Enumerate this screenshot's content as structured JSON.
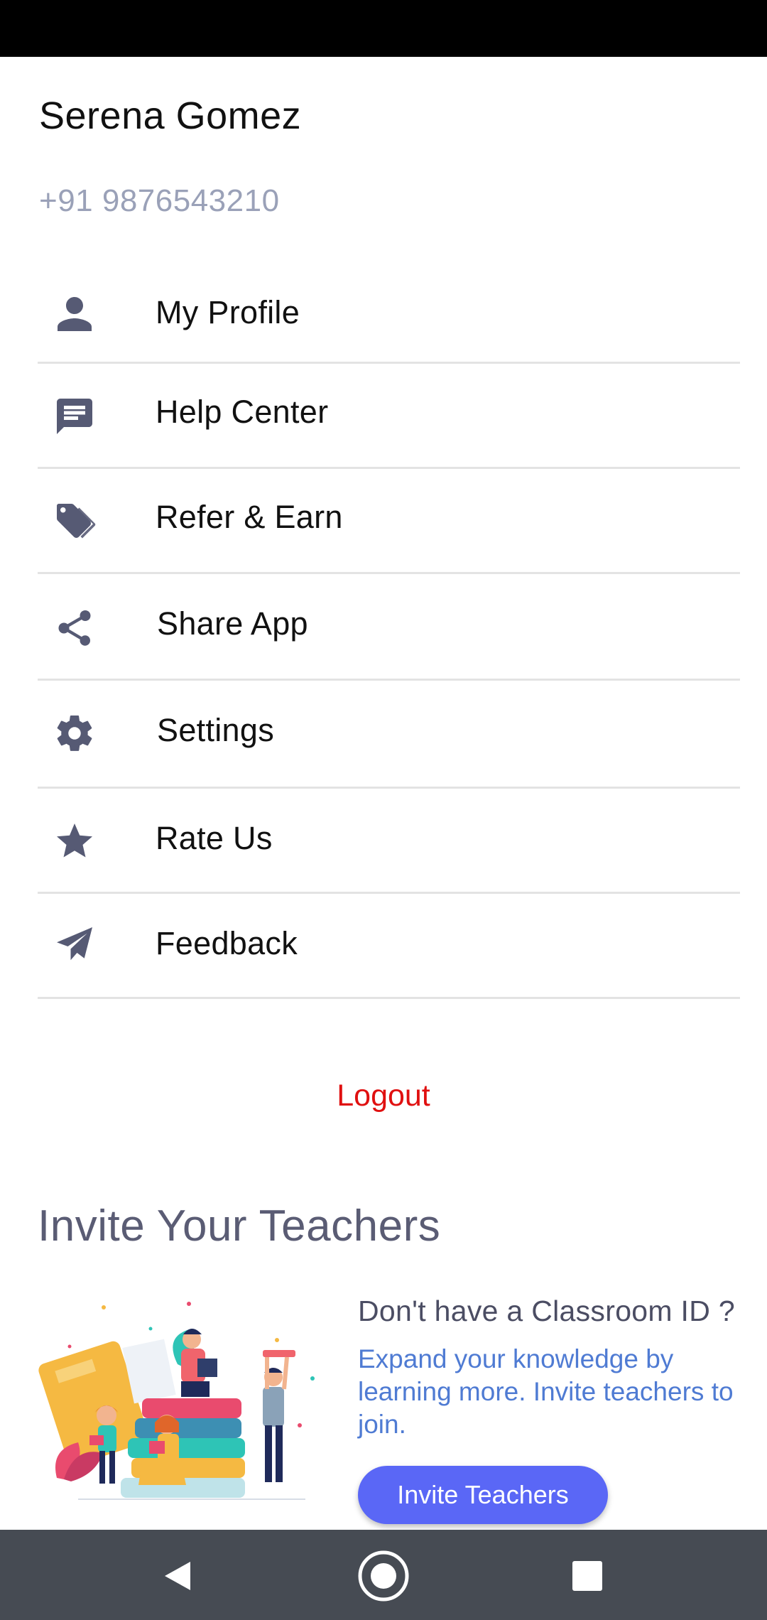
{
  "user": {
    "name": "Serena Gomez",
    "phone": "+91 9876543210"
  },
  "menu": {
    "items": [
      {
        "label": "My Profile",
        "icon": "person-icon"
      },
      {
        "label": "Help Center",
        "icon": "chat-icon"
      },
      {
        "label": "Refer & Earn",
        "icon": "tag-icon"
      },
      {
        "label": "Share App",
        "icon": "share-icon"
      },
      {
        "label": "Settings",
        "icon": "gear-icon"
      },
      {
        "label": "Rate Us",
        "icon": "star-icon"
      },
      {
        "label": "Feedback",
        "icon": "paper-plane-icon"
      }
    ]
  },
  "logout_label": "Logout",
  "invite": {
    "heading": "Invite Your Teachers",
    "title": "Don't have a Classroom ID ?",
    "description": "Expand your knowledge by learning more. Invite teachers to join.",
    "button_label": "Invite Teachers"
  },
  "nav": {
    "back": "back-icon",
    "home": "home-icon",
    "recents": "recents-icon"
  },
  "colors": {
    "icon": "#565a74",
    "logout": "#e01010",
    "accent_button": "#5a67f6",
    "description": "#4f7bd3",
    "nav_bar": "#464b53"
  }
}
